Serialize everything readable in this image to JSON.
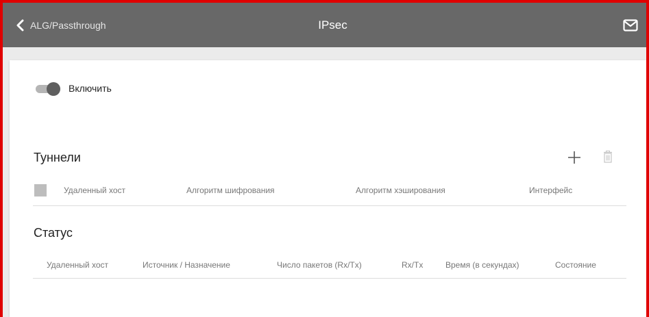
{
  "header": {
    "back_label": "ALG/Passthrough",
    "title": "IPsec",
    "back_icon": "chevron-left-icon",
    "mail_icon": "envelope-icon"
  },
  "enable": {
    "label": "Включить",
    "on": true
  },
  "tunnels": {
    "title": "Туннели",
    "columns": [
      "Удаленный хост",
      "Алгоритм шифрования",
      "Алгоритм хэширования",
      "Интерфейс"
    ],
    "add_icon": "plus-icon",
    "delete_icon": "trash-icon"
  },
  "status": {
    "title": "Статус",
    "columns": [
      "Удаленный хост",
      "Источник / Назначение",
      "Число пакетов (Rx/Tx)",
      "Rx/Tx",
      "Время (в секундах)",
      "Состояние"
    ]
  },
  "colors": {
    "header_bg": "#686868",
    "frame": "#e00000",
    "page_bg": "#ebebeb"
  }
}
